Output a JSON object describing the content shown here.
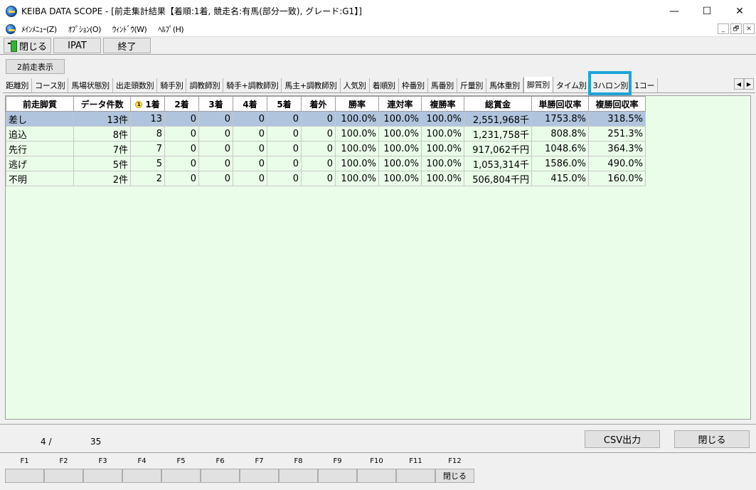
{
  "window": {
    "title": "KEIBA DATA SCOPE - [前走集計結果【着順:1着, 競走名:有馬(部分一致), グレード:G1】]",
    "minimize": "—",
    "maximize": "☐",
    "close": "✕"
  },
  "menu": {
    "items": [
      "ﾒｲﾝﾒﾆｭｰ(Z)",
      "ｵﾌﾟｼｮﾝ(O)",
      "ｳｨﾝﾄﾞｳ(W)",
      "ﾍﾙﾌﾟ(H)"
    ],
    "mdi_buttons": [
      "_",
      "🗗",
      "✕"
    ]
  },
  "toolbar": {
    "close_label": "閉じる",
    "ipat_label": "IPAT",
    "exit_label": "終了"
  },
  "prev_race_button": "2前走表示",
  "tabs": {
    "items": [
      "距離別",
      "コース別",
      "馬場状態別",
      "出走頭数別",
      "騎手別",
      "調教師別",
      "騎手+調教師別",
      "馬主+調教師別",
      "人気別",
      "着順別",
      "枠番別",
      "馬番別",
      "斤量別",
      "馬体重別",
      "脚質別",
      "タイム別",
      "3ハロン別",
      "1コー"
    ],
    "active": "脚質別",
    "scroll_left": "◀",
    "scroll_right": "▶"
  },
  "table": {
    "headers": [
      "前走脚質",
      "データ件数",
      "1着",
      "2着",
      "3着",
      "4着",
      "5着",
      "着外",
      "勝率",
      "連対率",
      "複勝率",
      "総賞金",
      "単勝回収率",
      "複勝回収率"
    ],
    "rank_badge": "1",
    "rows": [
      [
        "差し",
        "13件",
        "13",
        "0",
        "0",
        "0",
        "0",
        "0",
        "100.0%",
        "100.0%",
        "100.0%",
        "2,551,968千",
        "1753.8%",
        "318.5%"
      ],
      [
        "追込",
        "8件",
        "8",
        "0",
        "0",
        "0",
        "0",
        "0",
        "100.0%",
        "100.0%",
        "100.0%",
        "1,231,758千",
        "808.8%",
        "251.3%"
      ],
      [
        "先行",
        "7件",
        "7",
        "0",
        "0",
        "0",
        "0",
        "0",
        "100.0%",
        "100.0%",
        "100.0%",
        "917,062千円",
        "1048.6%",
        "364.3%"
      ],
      [
        "逃げ",
        "5件",
        "5",
        "0",
        "0",
        "0",
        "0",
        "0",
        "100.0%",
        "100.0%",
        "100.0%",
        "1,053,314千",
        "1586.0%",
        "490.0%"
      ],
      [
        "不明",
        "2件",
        "2",
        "0",
        "0",
        "0",
        "0",
        "0",
        "100.0%",
        "100.0%",
        "100.0%",
        "506,804千円",
        "415.0%",
        "160.0%"
      ]
    ],
    "selected_row": 0
  },
  "status": {
    "current": "4 /",
    "total": "35",
    "csv_label": "CSV出力",
    "close_label": "閉じる"
  },
  "fkeys": {
    "labels": [
      "F1",
      "F2",
      "F3",
      "F4",
      "F5",
      "F6",
      "F7",
      "F8",
      "F9",
      "F10",
      "F11",
      "F12"
    ],
    "f12_button": "閉じる"
  }
}
